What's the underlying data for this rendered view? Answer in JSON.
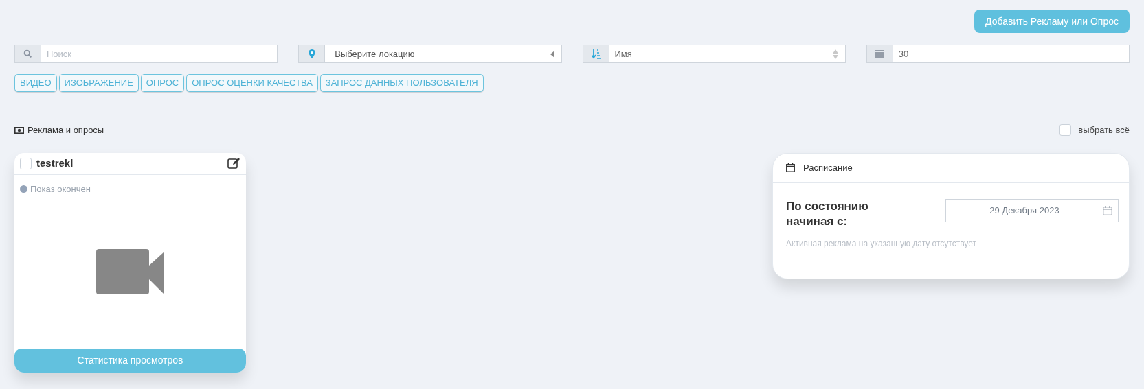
{
  "add_button": "Добавить Рекламу или Опрос",
  "filters": {
    "search": {
      "placeholder": "Поиск"
    },
    "location": {
      "value": "Выберите локацию"
    },
    "sort": {
      "value": "Имя"
    },
    "page_size": {
      "value": "30"
    }
  },
  "tags": [
    {
      "label": "ВИДЕО"
    },
    {
      "label": "ИЗОБРАЖЕНИЕ"
    },
    {
      "label": "ОПРОС"
    },
    {
      "label": "ОПРОС ОЦЕНКИ КАЧЕСТВА"
    },
    {
      "label": "ЗАПРОС ДАННЫХ ПОЛЬЗОВАТЕЛЯ"
    }
  ],
  "section_title": "Реклама и опросы",
  "select_all": {
    "label": "выбрать всё",
    "checked": false
  },
  "cards": [
    {
      "title": "testrekl",
      "checked": false,
      "status": "Показ окончен",
      "color": "#94a3b8",
      "kind": "video",
      "button": "Статистика просмотров"
    }
  ],
  "schedule": {
    "title": "Расписание",
    "label": "По состоянию начиная с:",
    "date": "29 Декабря 2023",
    "empty": "Активная реклама на указанную дату отсутствует"
  }
}
